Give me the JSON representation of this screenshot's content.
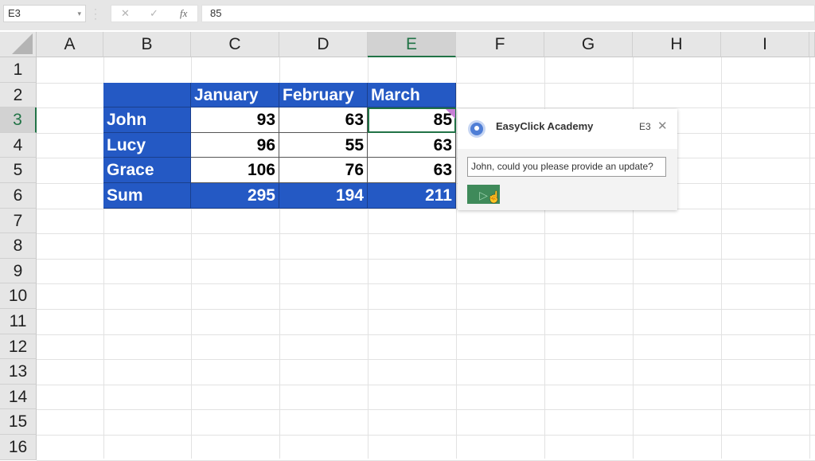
{
  "formula_bar": {
    "name_box": "E3",
    "cancel_icon": "✕",
    "enter_icon": "✓",
    "fx_label": "fx",
    "formula_value": "85"
  },
  "columns": [
    "A",
    "B",
    "C",
    "D",
    "E",
    "F",
    "G",
    "H",
    "I"
  ],
  "selected_column": "E",
  "rows": [
    "1",
    "2",
    "3",
    "4",
    "5",
    "6",
    "7",
    "8",
    "9",
    "10",
    "11",
    "12",
    "13",
    "14",
    "15",
    "16"
  ],
  "selected_row": "3",
  "table": {
    "headers": [
      "",
      "January",
      "February",
      "March"
    ],
    "rows": [
      {
        "name": "John",
        "values": [
          "93",
          "63",
          "85"
        ]
      },
      {
        "name": "Lucy",
        "values": [
          "96",
          "55",
          "63"
        ]
      },
      {
        "name": "Grace",
        "values": [
          "106",
          "76",
          "63"
        ]
      }
    ],
    "sum": {
      "name": "Sum",
      "values": [
        "295",
        "194",
        "211"
      ]
    }
  },
  "colors": {
    "table_header_blue": "#2459c4",
    "excel_green": "#217346",
    "comment_indicator": "#c77fd6",
    "send_button": "#3f8a5a"
  },
  "comment_panel": {
    "author": "EasyClick Academy",
    "cell_ref": "E3",
    "close_icon": "✕",
    "input_text": "John, could you please provide an update?",
    "send_icon": "▷"
  }
}
